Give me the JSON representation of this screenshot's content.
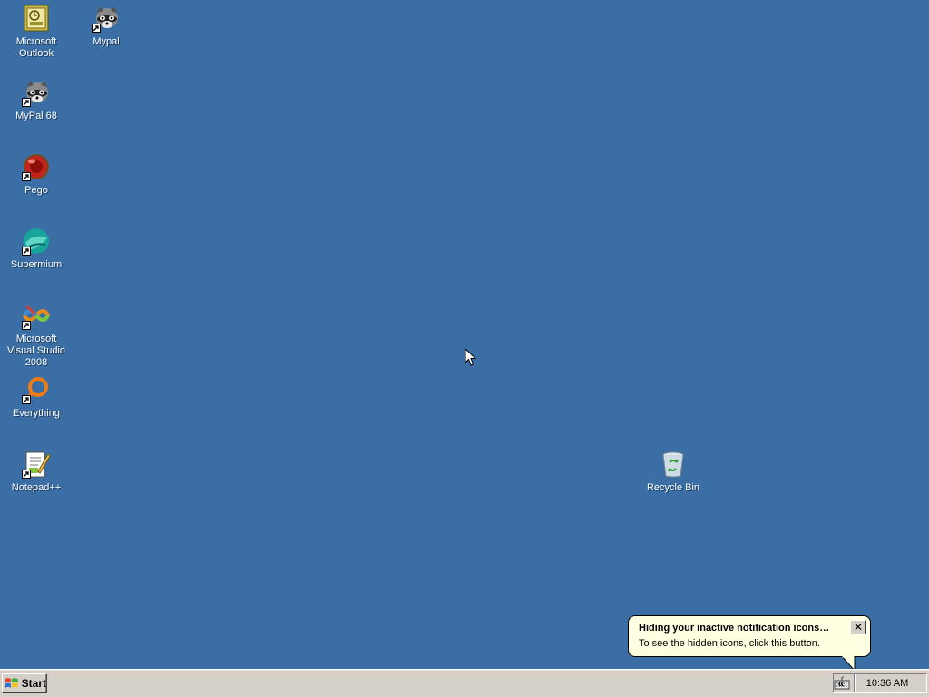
{
  "desktop": {
    "background": "#3a6ea5",
    "icons": [
      {
        "label": "Microsoft Outlook",
        "icon": "outlook-icon",
        "shortcut": false
      },
      {
        "label": "Mypal",
        "icon": "raccoon-icon",
        "shortcut": true
      },
      {
        "label": "MyPal 68",
        "icon": "raccoon-icon",
        "shortcut": true
      },
      {
        "label": "Pego",
        "icon": "red-ball-icon",
        "shortcut": true
      },
      {
        "label": "Supermium",
        "icon": "supermium-icon",
        "shortcut": true
      },
      {
        "label": "Microsoft Visual Studio 2008",
        "icon": "visual-studio-icon",
        "shortcut": true
      },
      {
        "label": "Everything",
        "icon": "everything-search-icon",
        "shortcut": true
      },
      {
        "label": "Notepad++",
        "icon": "notepadpp-icon",
        "shortcut": true
      },
      {
        "label": "Recycle Bin",
        "icon": "recycle-bin-icon",
        "shortcut": false
      }
    ]
  },
  "taskbar": {
    "start_label": "Start",
    "tray_expand": "«",
    "clock": "10:36 AM",
    "background": "#d4d0c8"
  },
  "balloon": {
    "title": "Hiding your inactive notification icons…",
    "text": "To see the hidden icons, click this button.",
    "close": "✕",
    "background": "#ffffe1"
  }
}
